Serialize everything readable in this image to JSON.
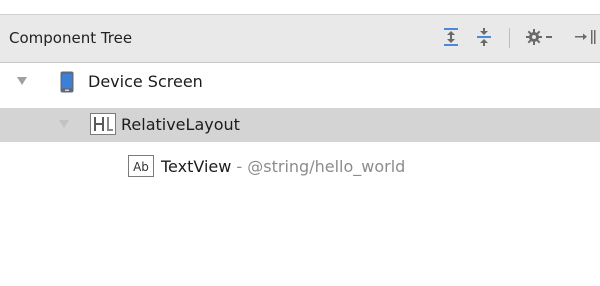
{
  "panel": {
    "title": "Component Tree",
    "toolbar": {
      "icons": [
        "expand-all-icon",
        "collapse-all-icon",
        "gear-dropdown-icon",
        "hide-panel-icon"
      ]
    }
  },
  "tree": {
    "device": {
      "label": "Device Screen",
      "icon": "device-phone-icon"
    },
    "relative_layout": {
      "label": "RelativeLayout",
      "icon": "relative-layout-icon"
    },
    "textview": {
      "label": "TextView",
      "separator": " - ",
      "reference": "@string/hello_world",
      "icon": "textview-ab-icon"
    }
  },
  "colors": {
    "header_bg": "#e9e9e9",
    "selected_row": "#d4d4d4",
    "phone_blue": "#3d7fd6"
  }
}
